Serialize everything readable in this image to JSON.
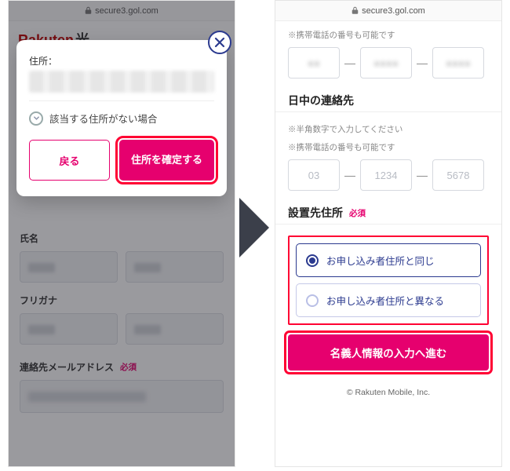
{
  "url": "secure3.gol.com",
  "left": {
    "brand_r": "Rakuten",
    "brand_h": "光",
    "modal": {
      "address_label": "住所：",
      "no_address": "該当する住所がない場合",
      "back": "戻る",
      "confirm": "住所を確定する"
    },
    "labels": {
      "name": "氏名",
      "furigana": "フリガナ",
      "email": "連絡先メールアドレス",
      "required": "必須"
    }
  },
  "right": {
    "hints": {
      "mobile_ok": "※携帯電話の番号も可能です",
      "halfwidth": "※半角数字で入力してください"
    },
    "section_contact": "日中の連絡先",
    "placeholders": {
      "p1": "03",
      "p2": "1234",
      "p3": "5678"
    },
    "section_addr": "設置先住所",
    "required": "必須",
    "radio_same": "お申し込み者住所と同じ",
    "radio_diff": "お申し込み者住所と異なる",
    "cta": "名義人情報の入力へ進む",
    "footer": "© Rakuten Mobile, Inc."
  }
}
